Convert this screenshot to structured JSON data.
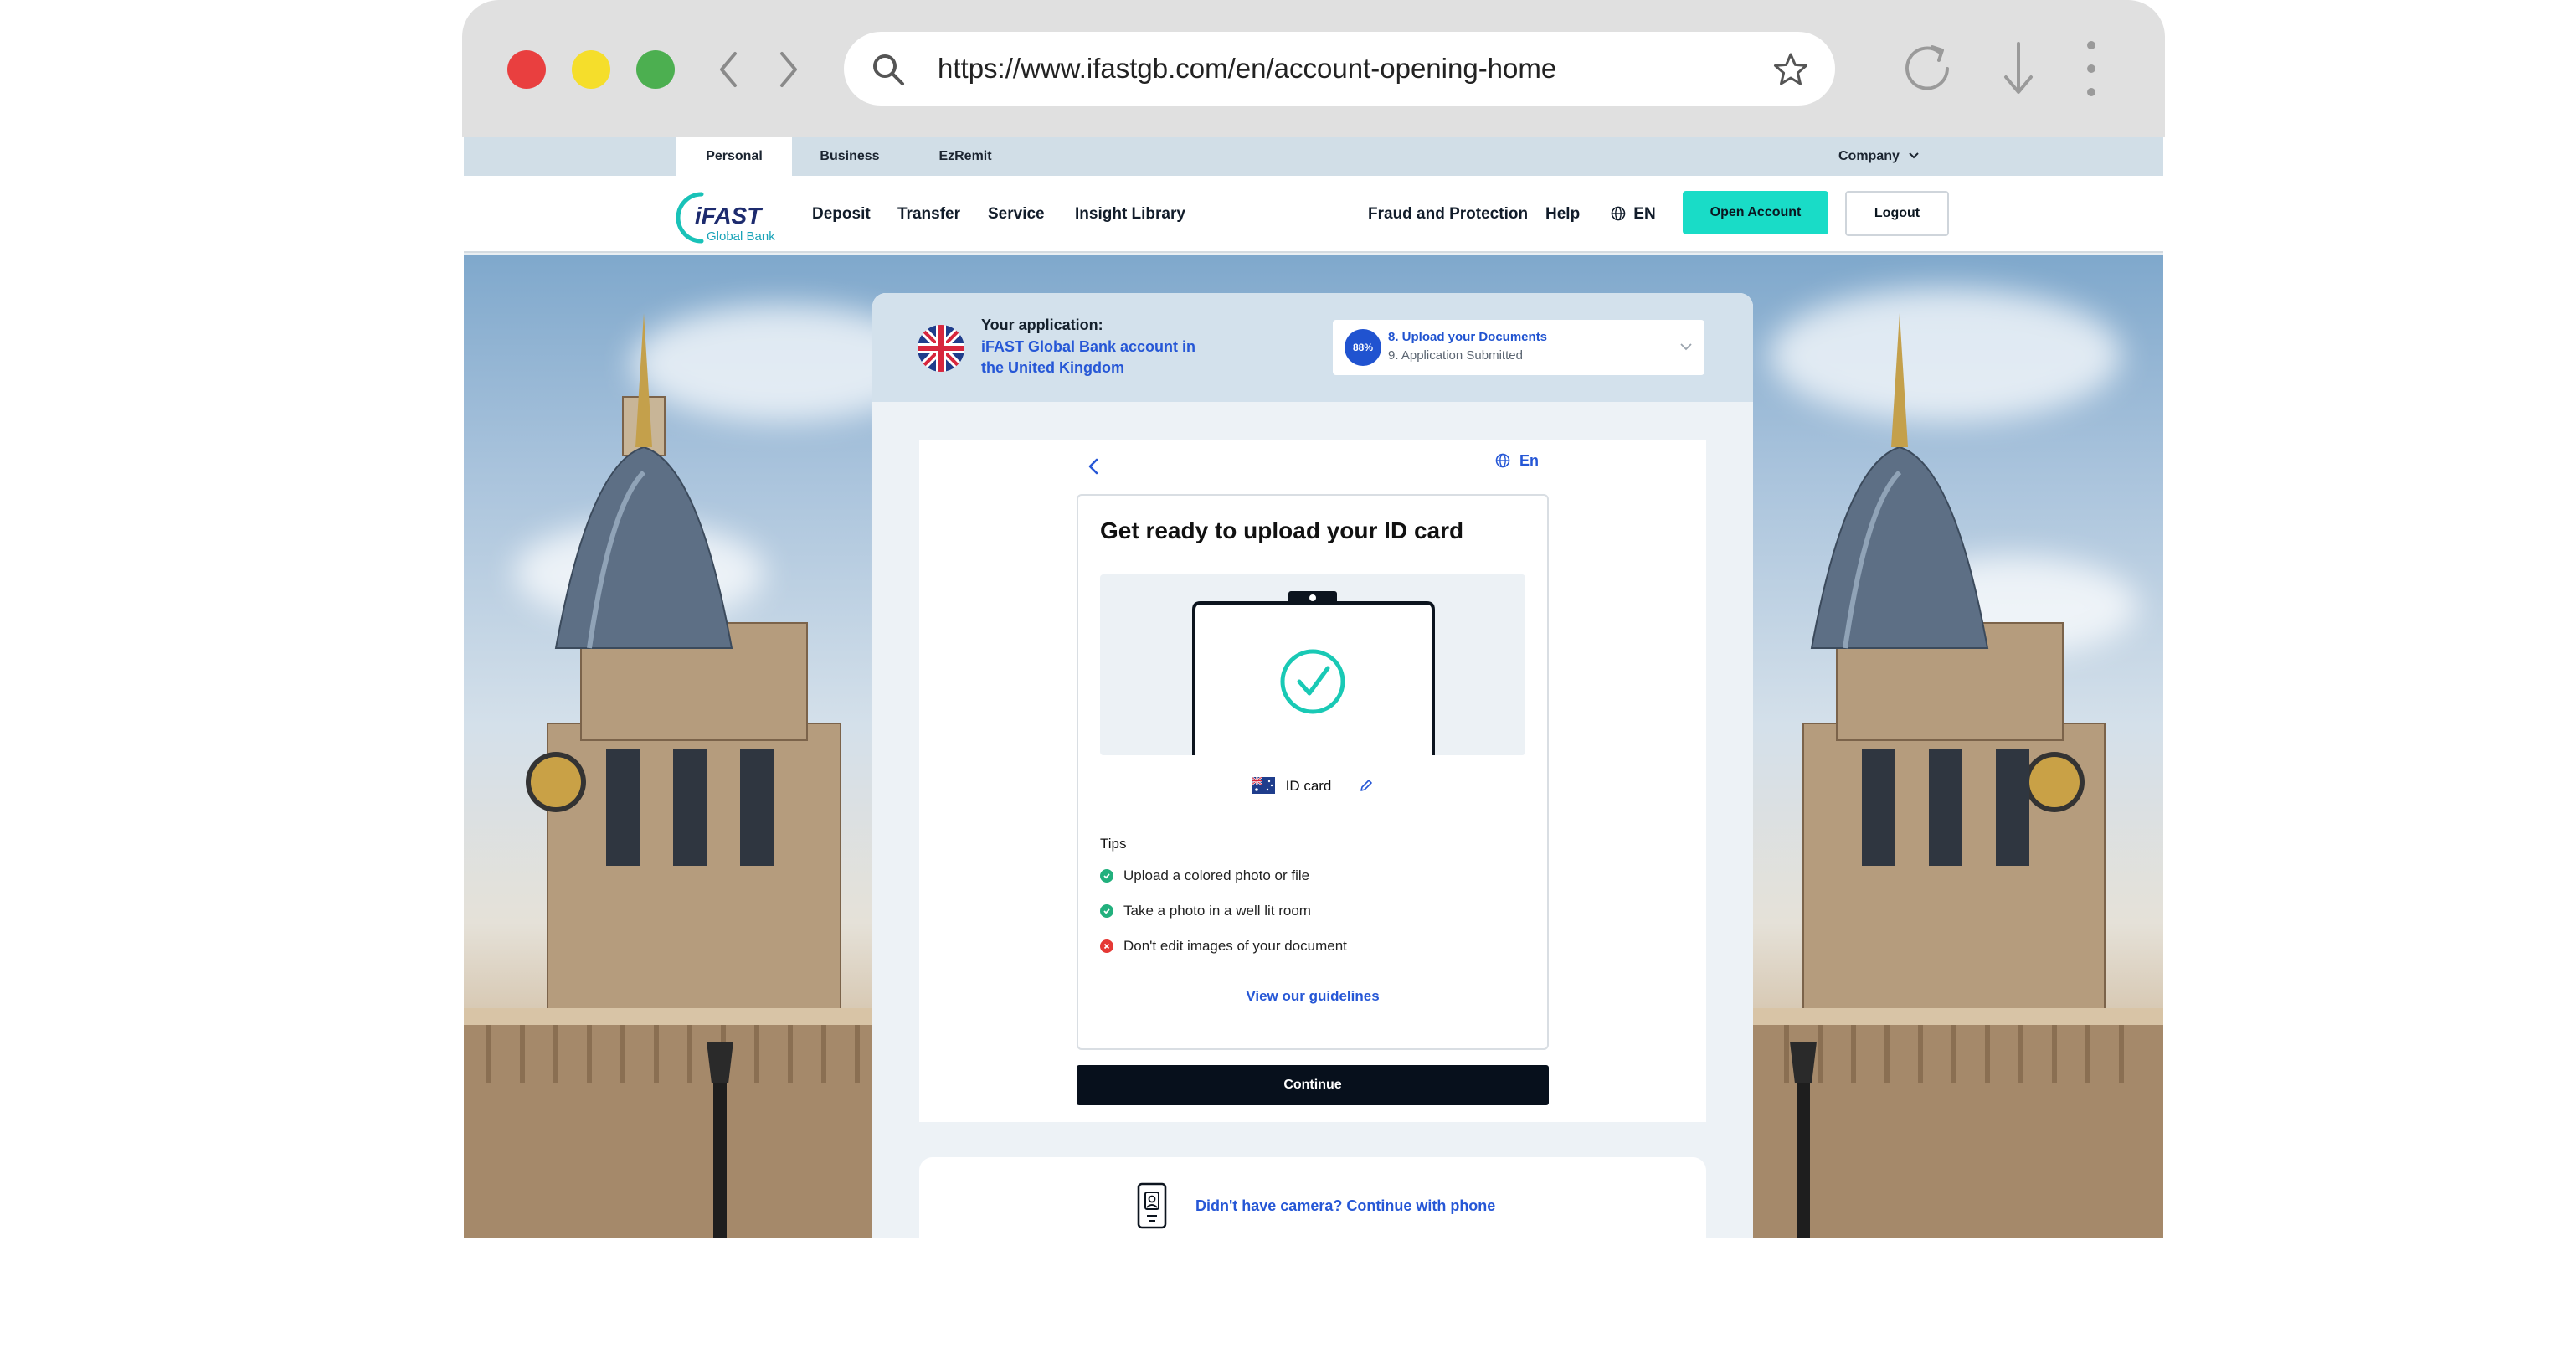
{
  "browser": {
    "url": "https://www.ifastgb.com/en/account-opening-home",
    "icons": [
      "back-icon",
      "forward-icon",
      "search-icon",
      "star-icon",
      "reload-icon",
      "download-icon",
      "menu-icon"
    ]
  },
  "site": {
    "segments": [
      "Personal",
      "Business",
      "EzRemit"
    ],
    "company": "Company",
    "logo": {
      "name": "iFAST",
      "sub": "Global Bank"
    },
    "nav": [
      "Deposit",
      "Transfer",
      "Service",
      "Insight Library"
    ],
    "nav_right": {
      "fraud": "Fraud and Protection",
      "help": "Help",
      "language": "EN"
    },
    "open_account": "Open Account",
    "logout": "Logout",
    "colors": {
      "accent": "#19dcc7",
      "link": "#2657d6",
      "dark": "#07101c"
    }
  },
  "application": {
    "label": "Your application:",
    "name": "iFAST Global Bank account in the United Kingdom",
    "progress_percent": "88%",
    "step_current": "8. Upload your Documents",
    "step_next": "9. Application Submitted"
  },
  "upload": {
    "language": "En",
    "title": "Get ready to upload your ID card",
    "document_type": "ID card",
    "tips_title": "Tips",
    "tips": [
      {
        "text": "Upload a colored photo or file",
        "status": "ok"
      },
      {
        "text": "Take a photo in a well lit room",
        "status": "ok"
      },
      {
        "text": "Don't edit images of your document",
        "status": "no"
      }
    ],
    "guidelines_link": "View our guidelines",
    "continue_label": "Continue",
    "phone_link": "Didn't have camera? Continue with phone"
  }
}
